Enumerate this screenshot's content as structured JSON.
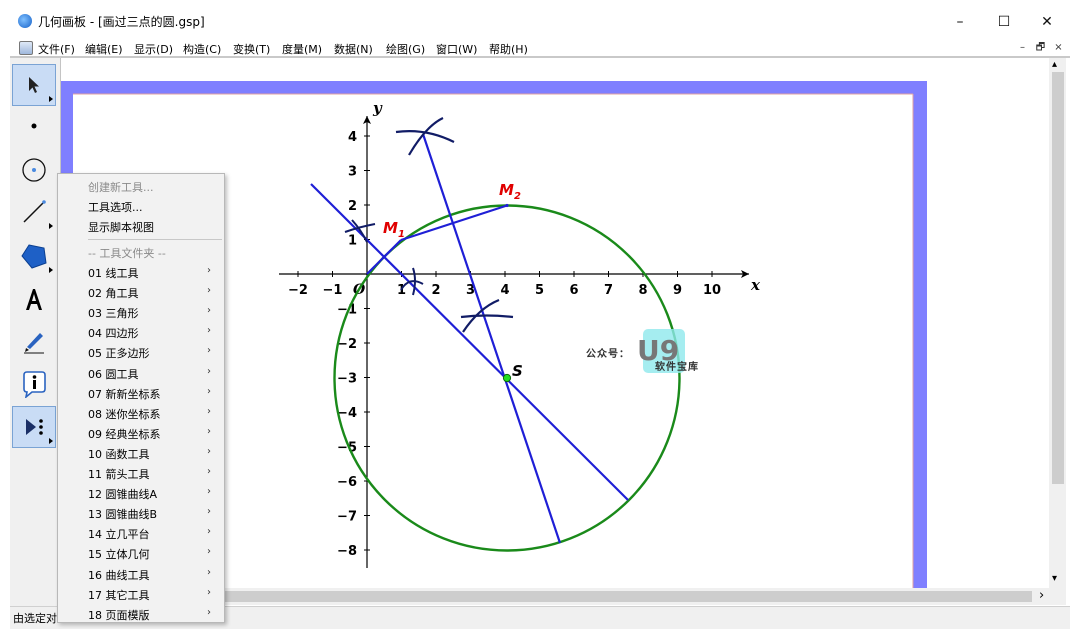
{
  "window": {
    "title": "几何画板 - [画过三点的圆.gsp]"
  },
  "window_controls": {
    "minimize": "–",
    "maximize": "☐",
    "close": "✕"
  },
  "menu": [
    "文件(F)",
    "编辑(E)",
    "显示(D)",
    "构造(C)",
    "变换(T)",
    "度量(M)",
    "数据(N)",
    "绘图(G)",
    "窗口(W)",
    "帮助(H)"
  ],
  "mdi_controls": {
    "minimize": "–",
    "restore": "🗗",
    "close": "×"
  },
  "toolbar": {
    "tools": [
      "arrow-tool",
      "point-tool",
      "compass-tool",
      "straightedge-tool",
      "polygon-tool",
      "text-tool",
      "marker-tool",
      "information-tool",
      "custom-tool"
    ],
    "active": [
      "arrow-tool",
      "custom-tool"
    ]
  },
  "popup": {
    "create_tool": "创建新工具...",
    "tool_options": "工具选项...",
    "show_script": "显示脚本视图",
    "folder_header": "-- 工具文件夹 --",
    "items": [
      "01 线工具",
      "02 角工具",
      "03 三角形",
      "04 四边形",
      "05 正多边形",
      "06 圆工具",
      "07 新新坐标系",
      "08 迷你坐标系",
      "09 经典坐标系",
      "10 函数工具",
      "11 箭头工具",
      "12 圆锥曲线A",
      "13 圆锥曲线B",
      "14 立几平台",
      "15 立体几何",
      "16 曲线工具",
      "17 其它工具",
      "18 页面模版"
    ],
    "submenu_arrow": "›"
  },
  "graph": {
    "x_axis_label": "x",
    "y_axis_label": "y",
    "origin_label": "O",
    "x_ticks": [
      "−2",
      "−1",
      "1",
      "2",
      "3",
      "4",
      "5",
      "6",
      "7",
      "8",
      "9",
      "10"
    ],
    "y_ticks": [
      "4",
      "3",
      "2",
      "1",
      "−1",
      "−2",
      "−3",
      "−4",
      "−5",
      "−6",
      "−7",
      "−8"
    ],
    "point_m1": {
      "letter": "M",
      "sub": "1"
    },
    "point_m2": {
      "letter": "M",
      "sub": "2"
    },
    "point_s": "S",
    "colors": {
      "circle": "#1a8a1a",
      "lines": "#1f1fd6",
      "points_label": "#e00000",
      "frame": "#7f7fff",
      "axes": "#000000"
    }
  },
  "watermark": {
    "prefix": "公众号：",
    "logo": "U9",
    "sub": "软件宝库"
  },
  "status": {
    "text": "由选定对"
  },
  "scroll": {
    "up": "▴",
    "down": "▾",
    "left": "‹",
    "right": "›"
  }
}
